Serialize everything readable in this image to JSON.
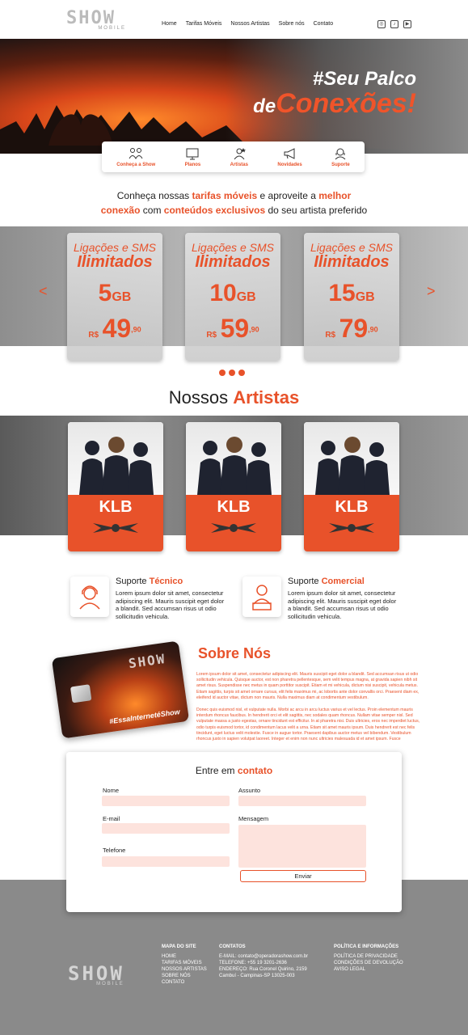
{
  "header": {
    "logo_main": "SHOW",
    "logo_sub": "MOBILE",
    "nav": [
      "Home",
      "Tarifas Móveis",
      "Nossos Artistas",
      "Sobre nós",
      "Contato"
    ]
  },
  "hero": {
    "line1_a": "#Seu",
    "line1_b": "Palco",
    "line2_a": "de",
    "line2_b": "Conexões!"
  },
  "quick_nav": [
    {
      "label": "Conheça a Show",
      "icon": "people-icon"
    },
    {
      "label": "Planos",
      "icon": "screen-icon"
    },
    {
      "label": "Artistas",
      "icon": "star-person-icon"
    },
    {
      "label": "Novidades",
      "icon": "megaphone-icon"
    },
    {
      "label": "Suporte",
      "icon": "headset-icon"
    }
  ],
  "intro": {
    "p1": "Conheça nossas ",
    "h1": "tarifas móveis",
    "p2": " e aproveite a ",
    "h2": "melhor",
    "h3": "conexão",
    "p3": " com ",
    "h4": "conteúdos exclusivos",
    "p4": " do seu artista preferido"
  },
  "plans": [
    {
      "line1": "Ligações e SMS",
      "line2": "Ilimitados",
      "gb": "5",
      "unit": "GB",
      "currency": "R$",
      "price": "49",
      "cents": ",90"
    },
    {
      "line1": "Ligações e SMS",
      "line2": "Ilimitados",
      "gb": "10",
      "unit": "GB",
      "currency": "R$",
      "price": "59",
      "cents": ",90"
    },
    {
      "line1": "Ligações e SMS",
      "line2": "Ilimitados",
      "gb": "15",
      "unit": "GB",
      "currency": "R$",
      "price": "79",
      "cents": ",90"
    }
  ],
  "carousel": {
    "prev": "<",
    "next": ">"
  },
  "artists_section": {
    "title_a": "Nossos",
    "title_b": "Artistas"
  },
  "artists": [
    {
      "name": "KLB"
    },
    {
      "name": "KLB"
    },
    {
      "name": "KLB"
    }
  ],
  "support": [
    {
      "title_a": "Suporte",
      "title_b": "Técnico",
      "text": "Lorem ipsum dolor sit amet, consectetur adipiscing elit. Mauris suscipit eget dolor a blandit. Sed accumsan risus ut odio sollicitudin vehicula."
    },
    {
      "title_a": "Suporte",
      "title_b": "Comercial",
      "text": "Lorem ipsum dolor sit amet, consectetur adipiscing elit. Mauris suscipit eget dolor a blandit. Sed accumsan risus ut odio sollicitudin vehicula."
    }
  ],
  "about": {
    "title_a": "Sobre",
    "title_b": "Nós",
    "sim_logo": "SHOW",
    "sim_tag": "#EssaInternetéShow",
    "p1": "Lorem ipsum dolor sit amet, consectetur adipiscing elit. Mauris suscipit eget dolor a blandit. Sed accumsan risus ut odio sollicitudin vehicula. Quisque auctor, est non pharetra pellentesque, sem velit tempus magna, at gravida sapien nibh sit amet risus. Suspendisse nec metus in quam porttitor suscipit. Etiam et mi vehicula, dictum nisi suscipit, vehicula metus. Etiam sagittis, turpis sit amet ornare cursus, elit felis maximus mi, ac lobortis ante dolor convallis orci. Praesent diam ex, eleifend id auctor vitae, dictum non mauris. Nulla maximus diam at condimentum vestibulum.",
    "p2": "Donec quis euismod nisl, et vulputate nulla. Morbi ac arcu in arcu luctus varius et vel lectus. Proin elementum mauris interdum rhoncus faucibus. In hendrerit orci et elit sagittis, nec sodales quam rhoncus. Nullam vitae semper nisl. Sed vulputate massa a justo egestas, ornare tincidunt est efficitur. In at pharetra nisi. Duis ultricies, eros nec imperdiet luctus, odio turpis euismod tortor, id condimentum lacus velit a urna. Etiam sit amet mauris ipsum. Duis hendrerit est nec felis tincidunt, eget luctus velit molestie. Fusce in augue tortor. Praesent dapibus auctor metus vel bibendum. Vestibulum rhoncus justo in sapien volutpat laoreet. Integer et enim non nunc ultricies malesuada id et amet ipsum. Fusce"
  },
  "contact": {
    "title_a": "Entre em",
    "title_b": "contato",
    "labels": {
      "nome": "Nome",
      "assunto": "Assunto",
      "email": "E-mail",
      "mensagem": "Mensagem",
      "telefone": "Telefone"
    },
    "send": "Enviar"
  },
  "footer": {
    "logo_main": "SHOW",
    "logo_sub": "MOBILE",
    "sitemap_title": "MAPA DO SITE",
    "sitemap": [
      "HOME",
      "TARIFAS MÓVEIS",
      "NOSSOS ARTISTAS",
      "SOBRE NÓS",
      "CONTATO"
    ],
    "contacts_title": "CONTATOS",
    "email": "E-MAIL: contato@operadorashow.com.br",
    "phone": "TELEFONE: +55 19 3201-2636",
    "address1": "ENDEREÇO: Rua Coronel Quirino, 2159",
    "address2": "Cambuí - Campinas-SP 13025-003",
    "policy_title": "POLÍTICA E INFORMAÇÕES",
    "policy": [
      "POLÍTICA DE PRIVACIDADE",
      "CONDIÇÕES DE DEVOLUÇÃO",
      "AVISO LEGAL"
    ]
  },
  "colors": {
    "accent": "#e8522a",
    "field": "#fde3dd",
    "footer": "#8a8a8a"
  }
}
